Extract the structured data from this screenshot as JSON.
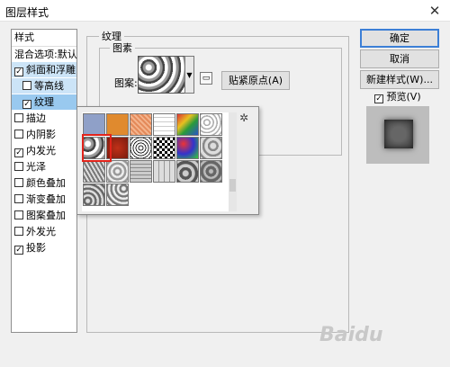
{
  "window": {
    "title": "图层样式",
    "close": "✕"
  },
  "styles_panel": {
    "header": "样式",
    "blend_options": "混合选项:默认",
    "items": [
      {
        "label": "斜面和浮雕",
        "checked": true
      },
      {
        "label": "等高线",
        "checked": false
      },
      {
        "label": "纹理",
        "checked": true
      },
      {
        "label": "描边",
        "checked": false
      },
      {
        "label": "内阴影",
        "checked": false
      },
      {
        "label": "内发光",
        "checked": true
      },
      {
        "label": "光泽",
        "checked": false
      },
      {
        "label": "颜色叠加",
        "checked": false
      },
      {
        "label": "渐变叠加",
        "checked": false
      },
      {
        "label": "图案叠加",
        "checked": false
      },
      {
        "label": "外发光",
        "checked": false
      },
      {
        "label": "投影",
        "checked": true
      }
    ]
  },
  "texture": {
    "section_title": "纹理",
    "group_title": "图素",
    "pattern_label": "图案:",
    "snap_button": "贴紧原点(A)"
  },
  "buttons": {
    "ok": "确定",
    "cancel": "取消",
    "new_style": "新建样式(W)...",
    "preview": "预览(V)",
    "preview_checked": true
  },
  "check_glyph": "✓",
  "watermark": "Baidu"
}
